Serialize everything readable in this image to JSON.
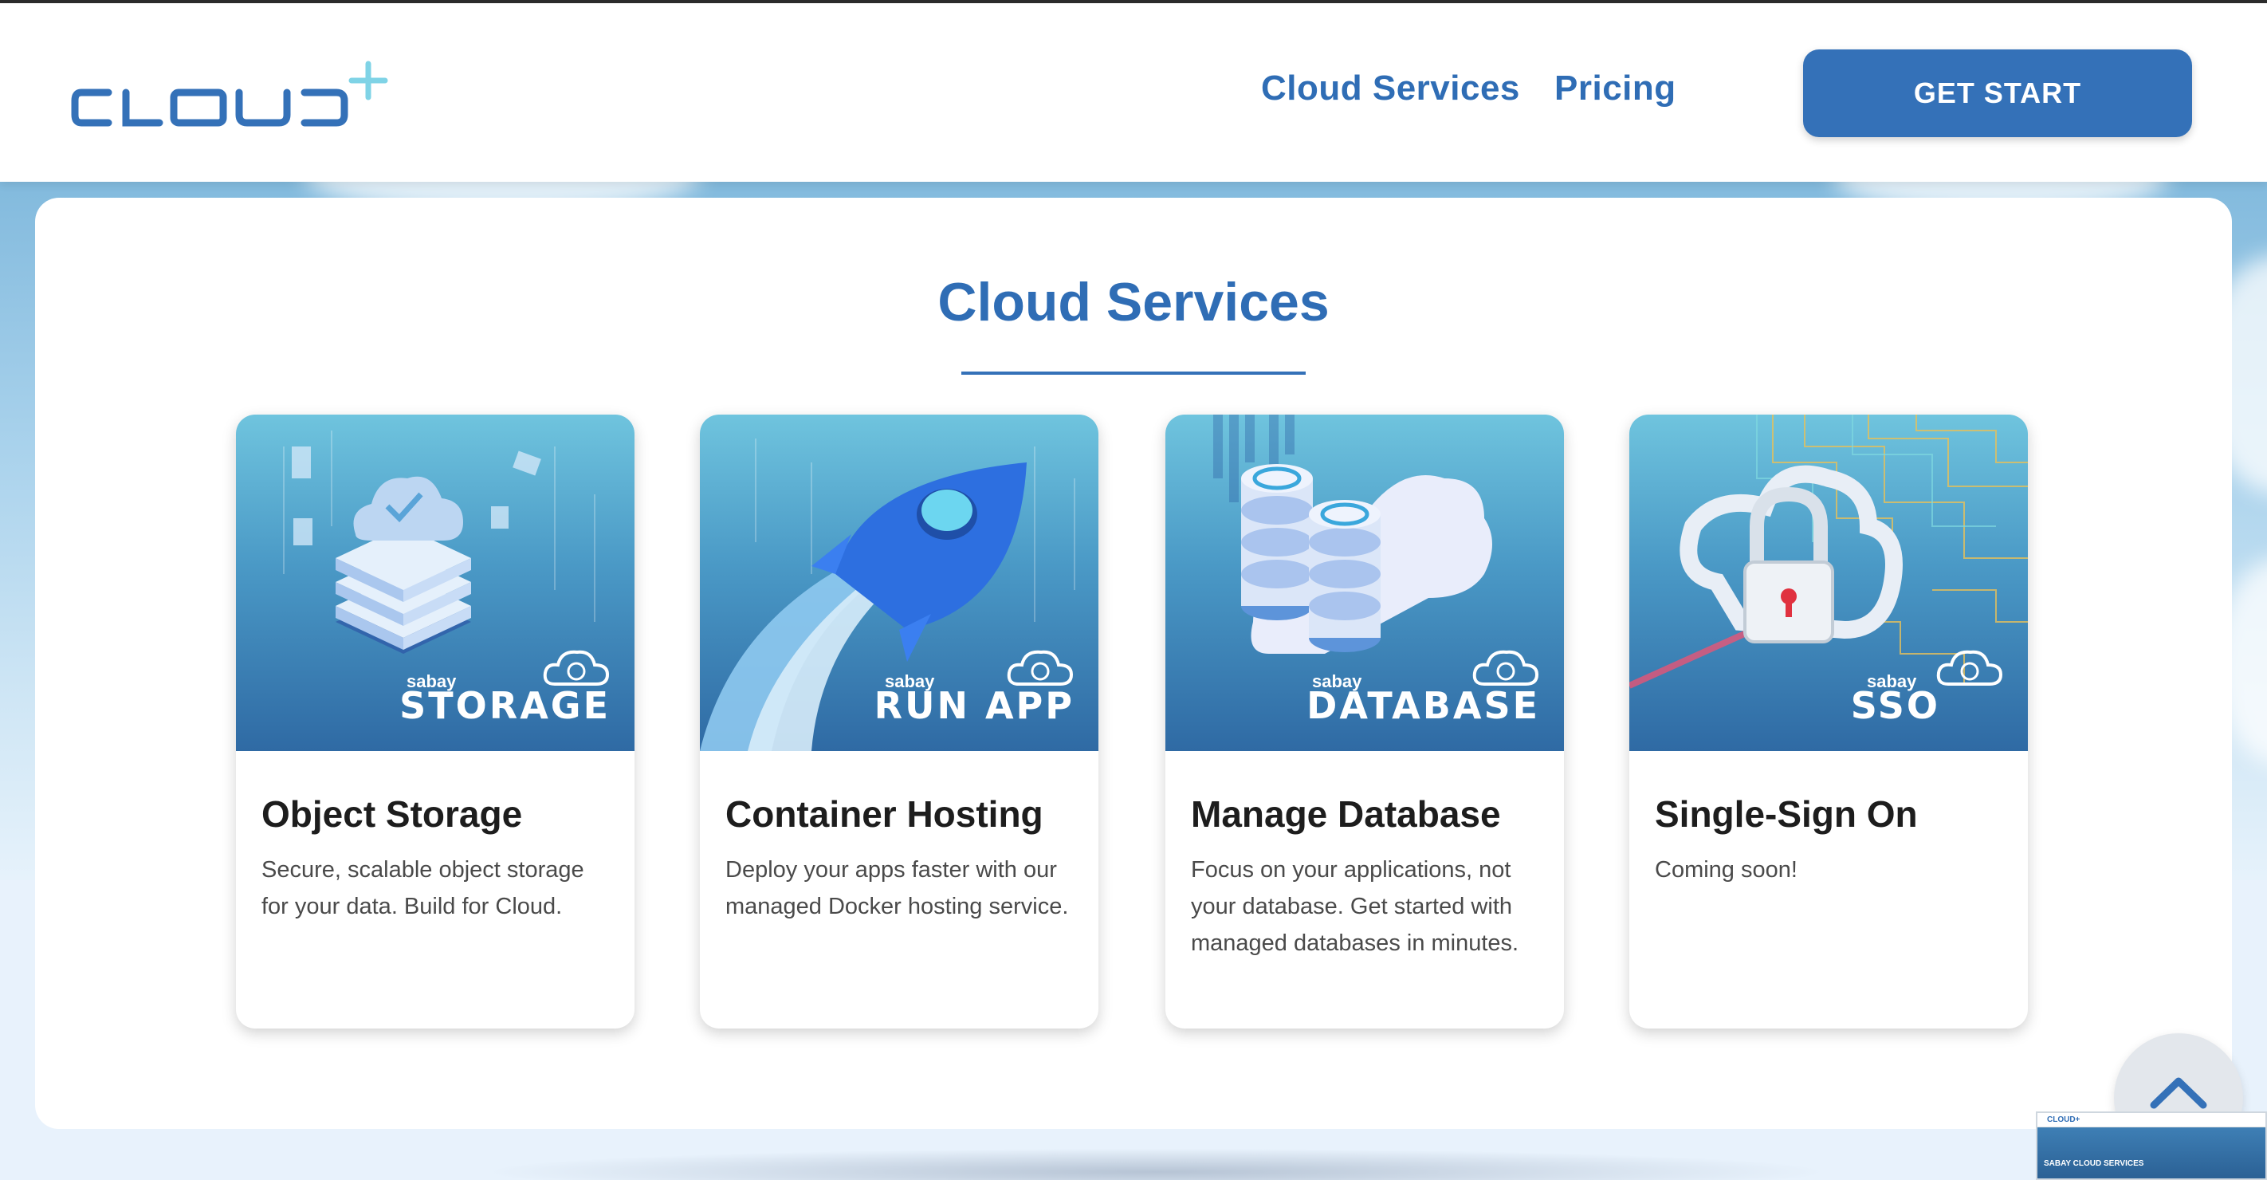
{
  "header": {
    "logo_text": "CLOUD+",
    "nav": [
      {
        "label": "Cloud Services"
      },
      {
        "label": "Pricing"
      }
    ],
    "cta_label": "GET START"
  },
  "main": {
    "section_title": "Cloud Services",
    "cards": [
      {
        "brand_small": "sabay",
        "brand_big": "STORAGE",
        "title": "Object Storage",
        "description": "Secure, scalable object storage for your data. Build for Cloud."
      },
      {
        "brand_small": "sabay",
        "brand_big": "RUN APP",
        "title": "Container Hosting",
        "description": "Deploy your apps faster with our managed Docker hosting service."
      },
      {
        "brand_small": "sabay",
        "brand_big": "DATABASE",
        "title": "Manage Database",
        "description": "Focus on your applications, not your database. Get started with managed databases in minutes."
      },
      {
        "brand_small": "sabay",
        "brand_big": "SSO",
        "title": "Single-Sign On",
        "description": "Coming soon!"
      }
    ]
  },
  "thumbnail": {
    "logo": "CLOUD+",
    "hero_text": "SABAY CLOUD SERVICES"
  },
  "colors": {
    "accent": "#3471b8",
    "heading": "#2f6db5",
    "text": "#4a4a4a"
  },
  "icons": [
    "chevron-up-icon",
    "cloud-brand-icon",
    "cloud-plus-logo"
  ]
}
